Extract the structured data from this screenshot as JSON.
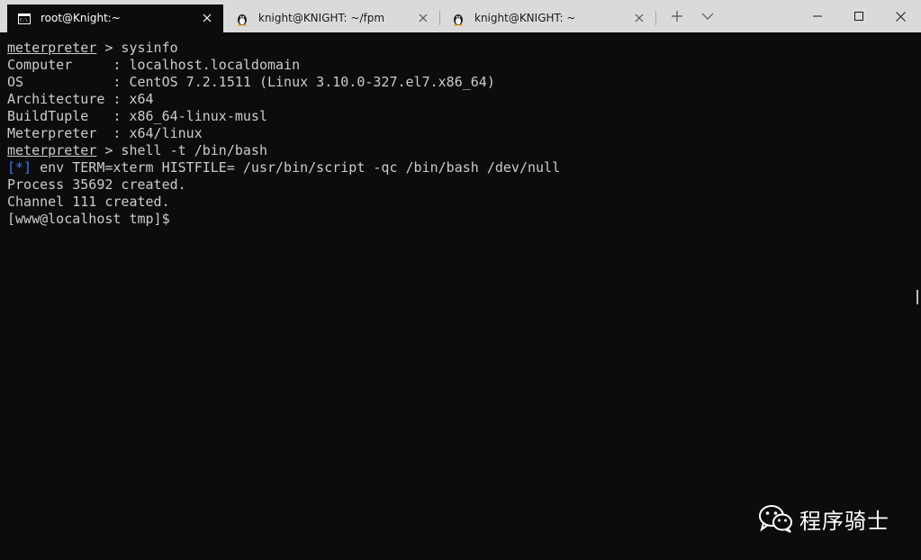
{
  "tabs": [
    {
      "title": "root@Knight:~",
      "icon": "cmd-icon",
      "active": true
    },
    {
      "title": "knight@KNIGHT: ~/fpm",
      "icon": "linux-penguin-icon",
      "active": false
    },
    {
      "title": "knight@KNIGHT: ~",
      "icon": "linux-penguin-icon",
      "active": false
    }
  ],
  "tab_controls": {
    "new_tab": "+",
    "dropdown": "chevron-down-icon"
  },
  "window_controls": {
    "minimize": "minimize-icon",
    "maximize": "maximize-icon",
    "close": "close-icon"
  },
  "terminal": {
    "lines": [
      {
        "prompt": "meterpreter",
        "rest": " > sysinfo"
      },
      {
        "text": "Computer     : localhost.localdomain"
      },
      {
        "text": "OS           : CentOS 7.2.1511 (Linux 3.10.0-327.el7.x86_64)"
      },
      {
        "text": "Architecture : x64"
      },
      {
        "text": "BuildTuple   : x86_64-linux-musl"
      },
      {
        "text": "Meterpreter  : x64/linux"
      },
      {
        "prompt": "meterpreter",
        "rest": " > shell -t /bin/bash"
      },
      {
        "marker": "[*]",
        "rest": " env TERM=xterm HISTFILE= /usr/bin/script -qc /bin/bash /dev/null"
      },
      {
        "text": "Process 35692 created."
      },
      {
        "text": "Channel 111 created."
      },
      {
        "text": "[www@localhost tmp]$"
      }
    ]
  },
  "watermark": {
    "text": "程序骑士",
    "icon": "wechat-icon"
  },
  "colors": {
    "background": "#0c0c0c",
    "foreground": "#cccccc",
    "info_marker": "#3b78ff",
    "titlebar": "#dadada"
  }
}
